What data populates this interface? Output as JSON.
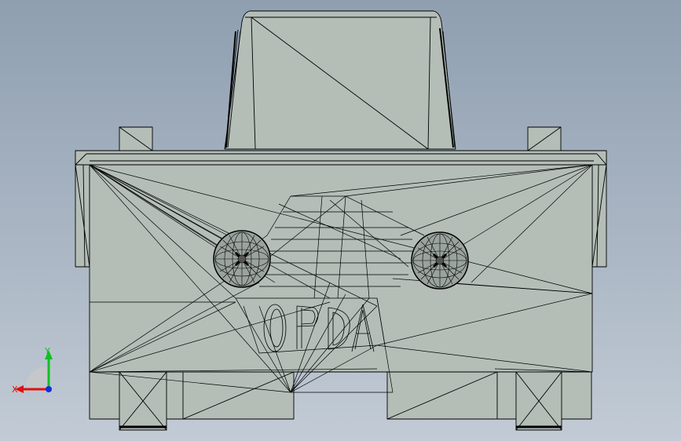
{
  "viewport": {
    "background_top": "#8f9fb0",
    "background_bottom": "#c2cbd5"
  },
  "model": {
    "face_color": "#b4beb7",
    "edge_color": "#000000",
    "screw_color": "#9aa39d"
  },
  "triad": {
    "x_label": "X",
    "y_label": "Y",
    "x_color": "#e01010",
    "y_color": "#10c020",
    "z_color": "#1030e0"
  }
}
